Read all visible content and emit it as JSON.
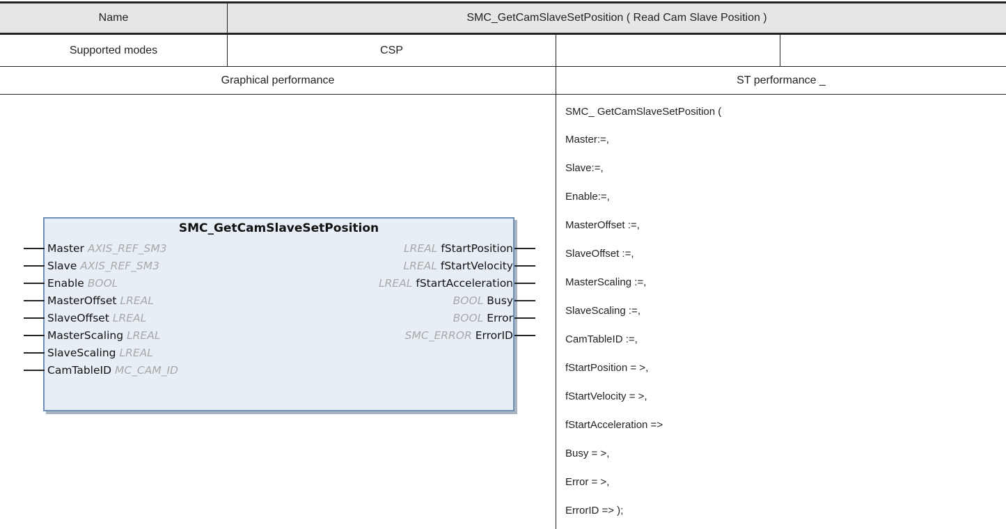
{
  "header": {
    "name_label": "Name",
    "function_title": "SMC_GetCamSlaveSetPosition ( Read Cam Slave Position )"
  },
  "modes": {
    "label": "Supported modes",
    "value": "CSP",
    "extra1": "",
    "extra2": ""
  },
  "sections": {
    "graphical": "Graphical performance",
    "st": "ST performance _"
  },
  "function_block": {
    "title": "SMC_GetCamSlaveSetPosition",
    "inputs": [
      {
        "name": "Master",
        "type": "AXIS_REF_SM3"
      },
      {
        "name": "Slave",
        "type": "AXIS_REF_SM3"
      },
      {
        "name": "Enable",
        "type": "BOOL"
      },
      {
        "name": "MasterOffset",
        "type": "LREAL"
      },
      {
        "name": "SlaveOffset",
        "type": "LREAL"
      },
      {
        "name": "MasterScaling",
        "type": "LREAL"
      },
      {
        "name": "SlaveScaling",
        "type": "LREAL"
      },
      {
        "name": "CamTableID",
        "type": "MC_CAM_ID"
      }
    ],
    "outputs": [
      {
        "type": "LREAL",
        "name": "fStartPosition"
      },
      {
        "type": "LREAL",
        "name": "fStartVelocity"
      },
      {
        "type": "LREAL",
        "name": "fStartAcceleration"
      },
      {
        "type": "BOOL",
        "name": "Busy"
      },
      {
        "type": "BOOL",
        "name": "Error"
      },
      {
        "type": "SMC_ERROR",
        "name": "ErrorID"
      }
    ]
  },
  "st_code": [
    "SMC_ GetCamSlaveSetPosition (",
    "Master:=,",
    "Slave:=,",
    "Enable:=,",
    "MasterOffset :=,",
    "SlaveOffset :=,",
    "MasterScaling :=,",
    "SlaveScaling :=,",
    "CamTableID :=,",
    "fStartPosition = >,",
    "fStartVelocity = >,",
    "fStartAcceleration =>",
    "Busy = >,",
    "Error = >,",
    "ErrorID => );"
  ]
}
